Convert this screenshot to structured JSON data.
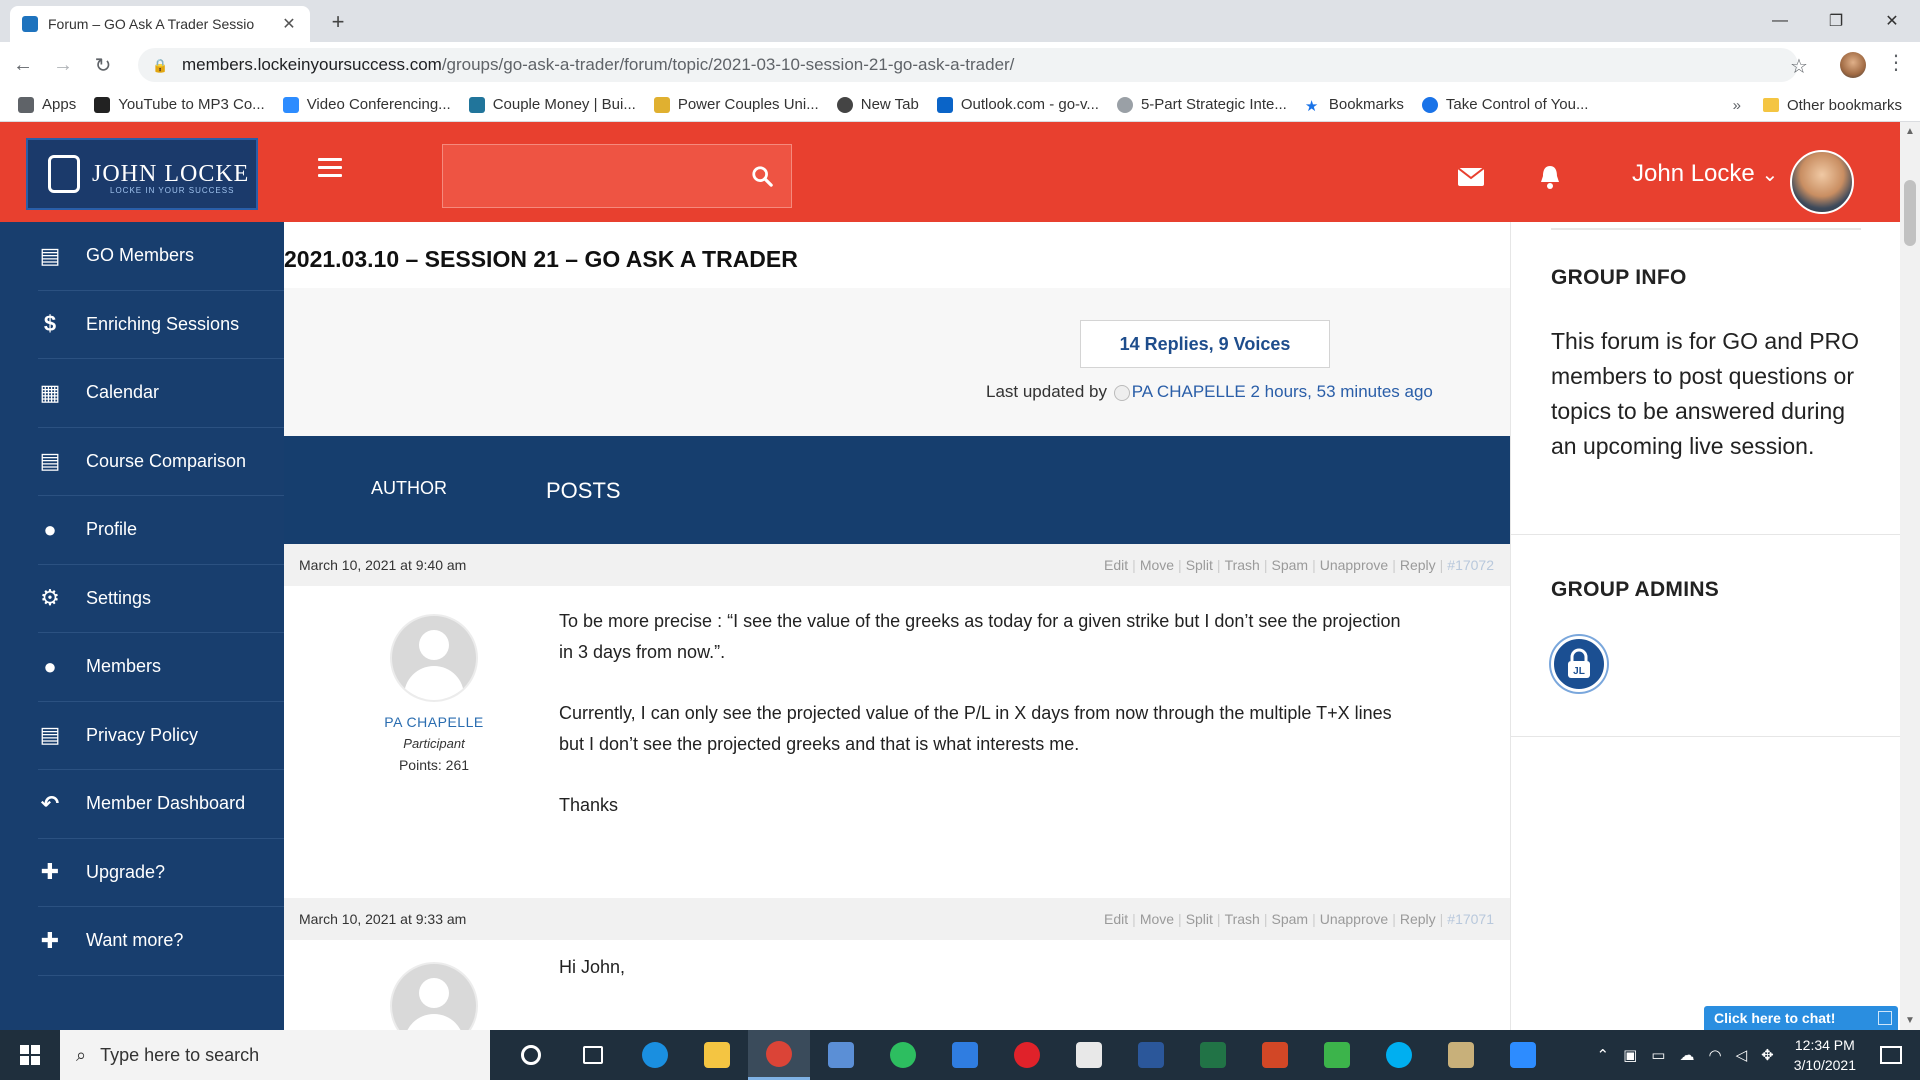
{
  "browser": {
    "tab_title": "Forum – GO Ask A Trader Sessio",
    "tab_close": "✕",
    "new_tab": "+",
    "url_host": "members.lockeinyoursuccess.com",
    "url_path": "/groups/go-ask-a-trader/forum/topic/2021-03-10-session-21-go-ask-a-trader/",
    "bookmarks": [
      {
        "label": "Apps",
        "icon": "apps-grid-icon",
        "color": "#5f6368"
      },
      {
        "label": "YouTube to MP3 Co...",
        "icon": "music-note-icon",
        "color": "#222222"
      },
      {
        "label": "Video Conferencing...",
        "icon": "zoom-icon",
        "color": "#2d8cff"
      },
      {
        "label": "Couple Money | Bui...",
        "icon": "wordpress-icon",
        "color": "#21759b"
      },
      {
        "label": "Power Couples Uni...",
        "icon": "bookmark-page-icon",
        "color": "#e0b030"
      },
      {
        "label": "New Tab",
        "icon": "globe-icon",
        "color": "#444444"
      },
      {
        "label": "Outlook.com - go-v...",
        "icon": "outlook-icon",
        "color": "#0a64c8"
      },
      {
        "label": "5-Part Strategic Inte...",
        "icon": "circle-logo-icon",
        "color": "#9aa0a6"
      },
      {
        "label": "Bookmarks",
        "icon": "star-icon",
        "color": "#1a73e8"
      },
      {
        "label": "Take Control of You...",
        "icon": "edge-icon",
        "color": "#1a73e8"
      }
    ],
    "bookmarks_more": "»",
    "other_bookmarks": "Other bookmarks"
  },
  "header": {
    "logo_name": "JOHN LOCKE",
    "logo_tagline": "LOCKE IN YOUR SUCCESS",
    "user_name": "John Locke",
    "user_chevron": "⌄"
  },
  "sidebar": {
    "items": [
      {
        "label": "GO Members",
        "icon": "document-icon",
        "glyph": "▤"
      },
      {
        "label": "Enriching Sessions",
        "icon": "dollar-icon",
        "glyph": "$"
      },
      {
        "label": "Calendar",
        "icon": "calendar-icon",
        "glyph": "▦"
      },
      {
        "label": "Course Comparison",
        "icon": "document-icon",
        "glyph": "▤"
      },
      {
        "label": "Profile",
        "icon": "user-icon",
        "glyph": "●"
      },
      {
        "label": "Settings",
        "icon": "gears-icon",
        "glyph": "⚙"
      },
      {
        "label": "Members",
        "icon": "users-icon",
        "glyph": "●"
      },
      {
        "label": "Privacy Policy",
        "icon": "document-icon",
        "glyph": "▤"
      },
      {
        "label": "Member Dashboard",
        "icon": "reply-all-icon",
        "glyph": "↶"
      },
      {
        "label": "Upgrade?",
        "icon": "plus-icon",
        "glyph": "✚"
      },
      {
        "label": "Want more?",
        "icon": "plus-icon",
        "glyph": "✚"
      }
    ]
  },
  "topic": {
    "title": "2021.03.10 – SESSION 21 – GO ASK A TRADER",
    "replies_voices": "14 Replies, 9 Voices",
    "last_updated_prefix": "Last updated by",
    "last_updated_author": "PA CHAPELLE",
    "last_updated_time": "2 hours, 53 minutes ago",
    "col_author": "AUTHOR",
    "col_posts": "POSTS"
  },
  "admin_links": [
    "Edit",
    "Move",
    "Split",
    "Trash",
    "Spam",
    "Unapprove",
    "Reply"
  ],
  "posts": [
    {
      "date": "March 10, 2021 at 9:40 am",
      "id": "#17072",
      "author": "PA CHAPELLE",
      "role": "Participant",
      "points": "Points: 261",
      "paragraphs": [
        "To be more precise : “I see the value of the greeks as today for a given strike but I don’t see the projection in 3 days from now.”.",
        "Currently, I can only see the projected value of the P/L in X days from now through the multiple T+X lines but I don’t see the projected greeks and that is what interests me.",
        "Thanks"
      ]
    },
    {
      "date": "March 10, 2021 at 9:33 am",
      "id": "#17071",
      "paragraphs": [
        "Hi John,"
      ]
    }
  ],
  "right_sidebar": {
    "group_info_heading": "GROUP INFO",
    "group_info_text": "This forum is for GO and PRO members to post questions or topics to be answered during an upcoming live session.",
    "group_admins_heading": "GROUP ADMINS"
  },
  "chat_widget": "Click here to chat!",
  "taskbar": {
    "search_placeholder": "Type here to search",
    "apps": [
      {
        "icon": "cortana-icon",
        "color": "#1f2f3d"
      },
      {
        "icon": "task-view-icon",
        "color": "#1f2f3d"
      },
      {
        "icon": "edge-icon",
        "color": "#1a8fe0"
      },
      {
        "icon": "file-explorer-icon",
        "color": "#f4c542"
      },
      {
        "icon": "chrome-icon",
        "color": "#db4437"
      },
      {
        "icon": "notepad-icon",
        "color": "#5b8fd6"
      },
      {
        "icon": "evernote-icon",
        "color": "#2dbe60"
      },
      {
        "icon": "todo-icon",
        "color": "#2f7de1"
      },
      {
        "icon": "opera-icon",
        "color": "#e0222a"
      },
      {
        "icon": "slack-icon",
        "color": "#e8e8e8"
      },
      {
        "icon": "word-icon",
        "color": "#2b579a"
      },
      {
        "icon": "excel-icon",
        "color": "#217346"
      },
      {
        "icon": "powerpoint-icon",
        "color": "#d24726"
      },
      {
        "icon": "spark-icon",
        "color": "#3cb44b"
      },
      {
        "icon": "skype-icon",
        "color": "#00aff0"
      },
      {
        "icon": "bug-icon",
        "color": "#c8b07a"
      },
      {
        "icon": "zoom-icon",
        "color": "#2d8cff"
      }
    ],
    "time": "12:34 PM",
    "date": "3/10/2021"
  }
}
